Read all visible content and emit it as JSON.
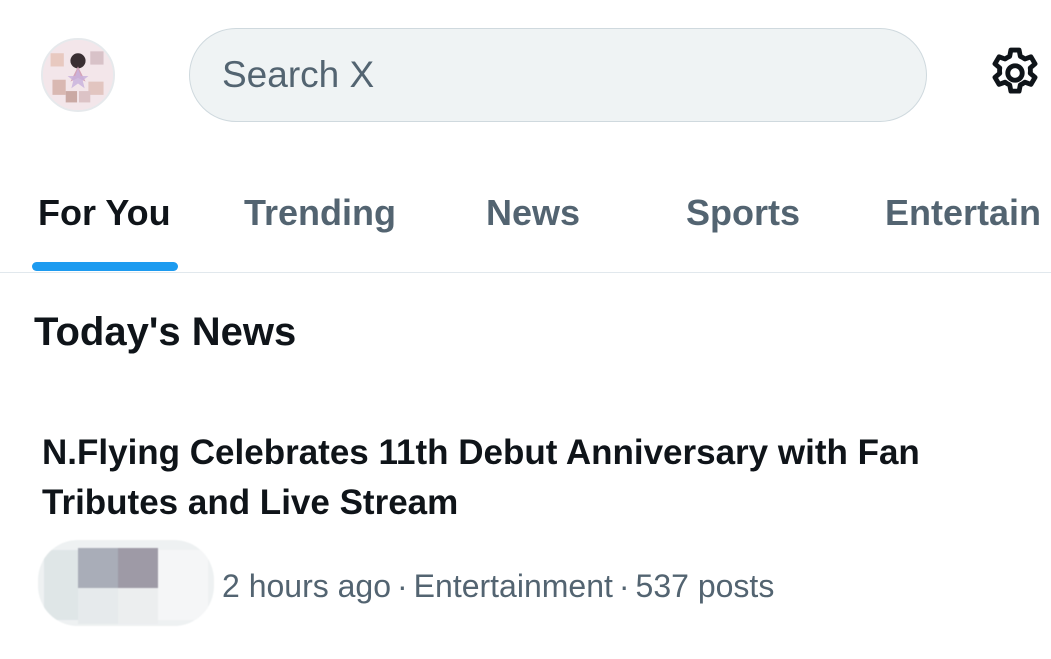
{
  "header": {
    "search_placeholder": "Search X",
    "avatar_icon": "profile-avatar",
    "settings_icon": "gear-icon"
  },
  "tabs": [
    {
      "label": "For You",
      "active": true
    },
    {
      "label": "Trending",
      "active": false
    },
    {
      "label": "News",
      "active": false
    },
    {
      "label": "Sports",
      "active": false
    },
    {
      "label": "Entertain",
      "active": false
    }
  ],
  "section": {
    "title": "Today's News"
  },
  "story": {
    "headline": "N.Flying Celebrates 11th Debut Anniversary with Fan Tributes and Live Stream",
    "time": "2 hours ago",
    "category": "Entertainment",
    "posts": "537 posts",
    "separator": "·"
  },
  "colors": {
    "accent": "#1d9bf0",
    "text_primary": "#0f1419",
    "text_secondary": "#536471",
    "search_bg": "#eff3f4"
  }
}
